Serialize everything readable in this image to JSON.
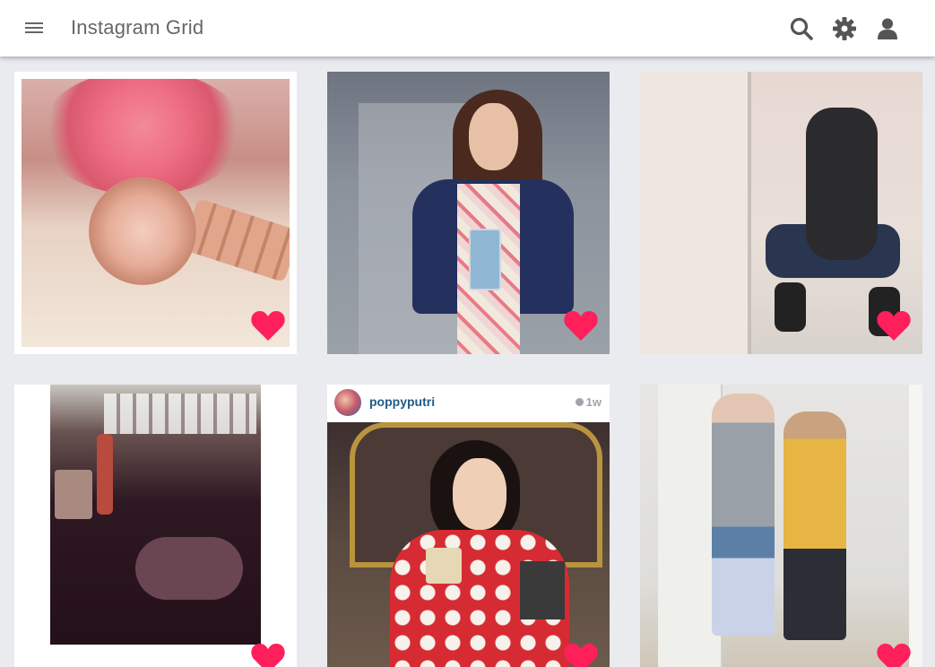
{
  "appbar": {
    "title": "Instagram Grid",
    "icons": [
      "menu-icon",
      "search-icon",
      "gear-icon",
      "user-icon"
    ]
  },
  "posts": [
    {
      "description_icon": "heart-icon",
      "liked": true
    },
    {
      "description_icon": "heart-icon",
      "liked": true
    },
    {
      "description_icon": "heart-icon",
      "liked": true
    },
    {
      "description_icon": "heart-icon",
      "liked": true
    },
    {
      "username": "poppyputri",
      "time": "1w",
      "description_icon": "heart-icon",
      "liked": true
    },
    {
      "description_icon": "heart-icon",
      "liked": true
    }
  ],
  "colors": {
    "heart": "#ff1f5b",
    "username": "#215b87",
    "title": "#666666",
    "background": "#e9ebee"
  }
}
